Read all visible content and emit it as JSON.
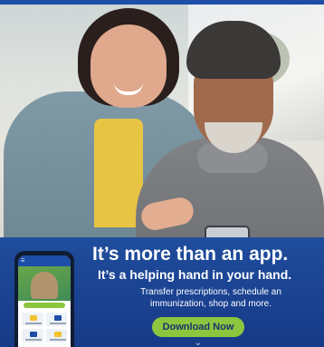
{
  "ad": {
    "headline": "It’s more than an app.",
    "subheadline": "It’s a helping hand in your hand.",
    "body": "Transfer prescriptions, schedule an immunization, shop and more.",
    "cta_label": "Download Now",
    "chevron_icon": "chevron-down-icon"
  },
  "phone_mockup": {
    "menu_icon": "hamburger-menu-icon"
  },
  "colors": {
    "brand_blue": "#1d4ea8",
    "panel_blue": "#1a4190",
    "cta_green": "#8cc63f",
    "cta_text": "#17336b"
  }
}
